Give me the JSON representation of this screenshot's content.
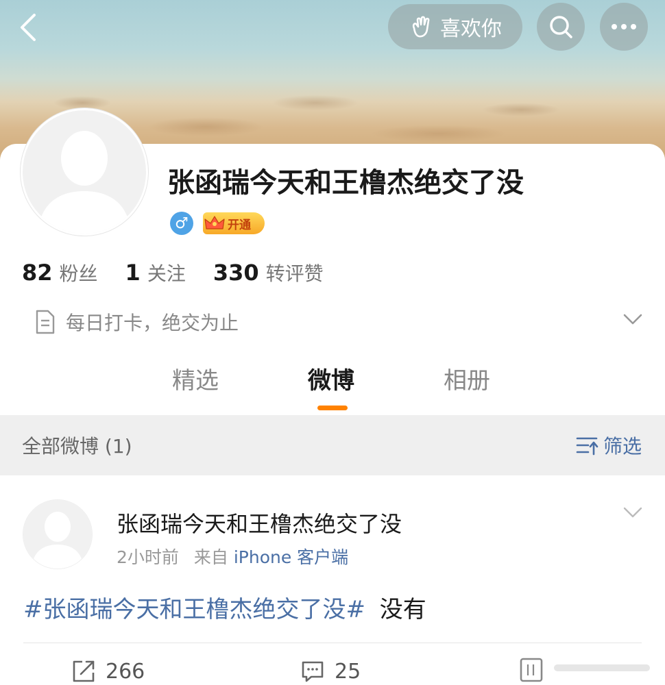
{
  "header": {
    "like_button_label": "喜欢你",
    "icons": [
      "back-arrow-icon",
      "hand-wave-icon",
      "search-icon",
      "more-icon"
    ]
  },
  "profile": {
    "username": "张函瑞今天和王橹杰绝交了没",
    "gender_symbol": "♂",
    "vip_badge_label": "开通",
    "stats": [
      {
        "value": "82",
        "label": "粉丝"
      },
      {
        "value": "1",
        "label": "关注"
      },
      {
        "value": "330",
        "label": "转评赞"
      }
    ],
    "bio": "每日打卡，绝交为止"
  },
  "tabs": [
    {
      "label": "精选",
      "active": false
    },
    {
      "label": "微博",
      "active": true
    },
    {
      "label": "相册",
      "active": false
    }
  ],
  "filter_bar": {
    "title": "全部微博 (1)",
    "filter_label": "筛选"
  },
  "post": {
    "author": "张函瑞今天和王橹杰绝交了没",
    "time": "2小时前",
    "source_prefix": "来自",
    "source": "iPhone 客户端",
    "topic": "#张函瑞今天和王橹杰绝交了没#",
    "text": "没有",
    "repost_count": "266",
    "comment_count": "25"
  },
  "colors": {
    "accent_orange": "#ff8200",
    "link_blue": "#4a6fa5",
    "gender_blue": "#4fa3e6",
    "vip_gold": "#f7a928"
  }
}
